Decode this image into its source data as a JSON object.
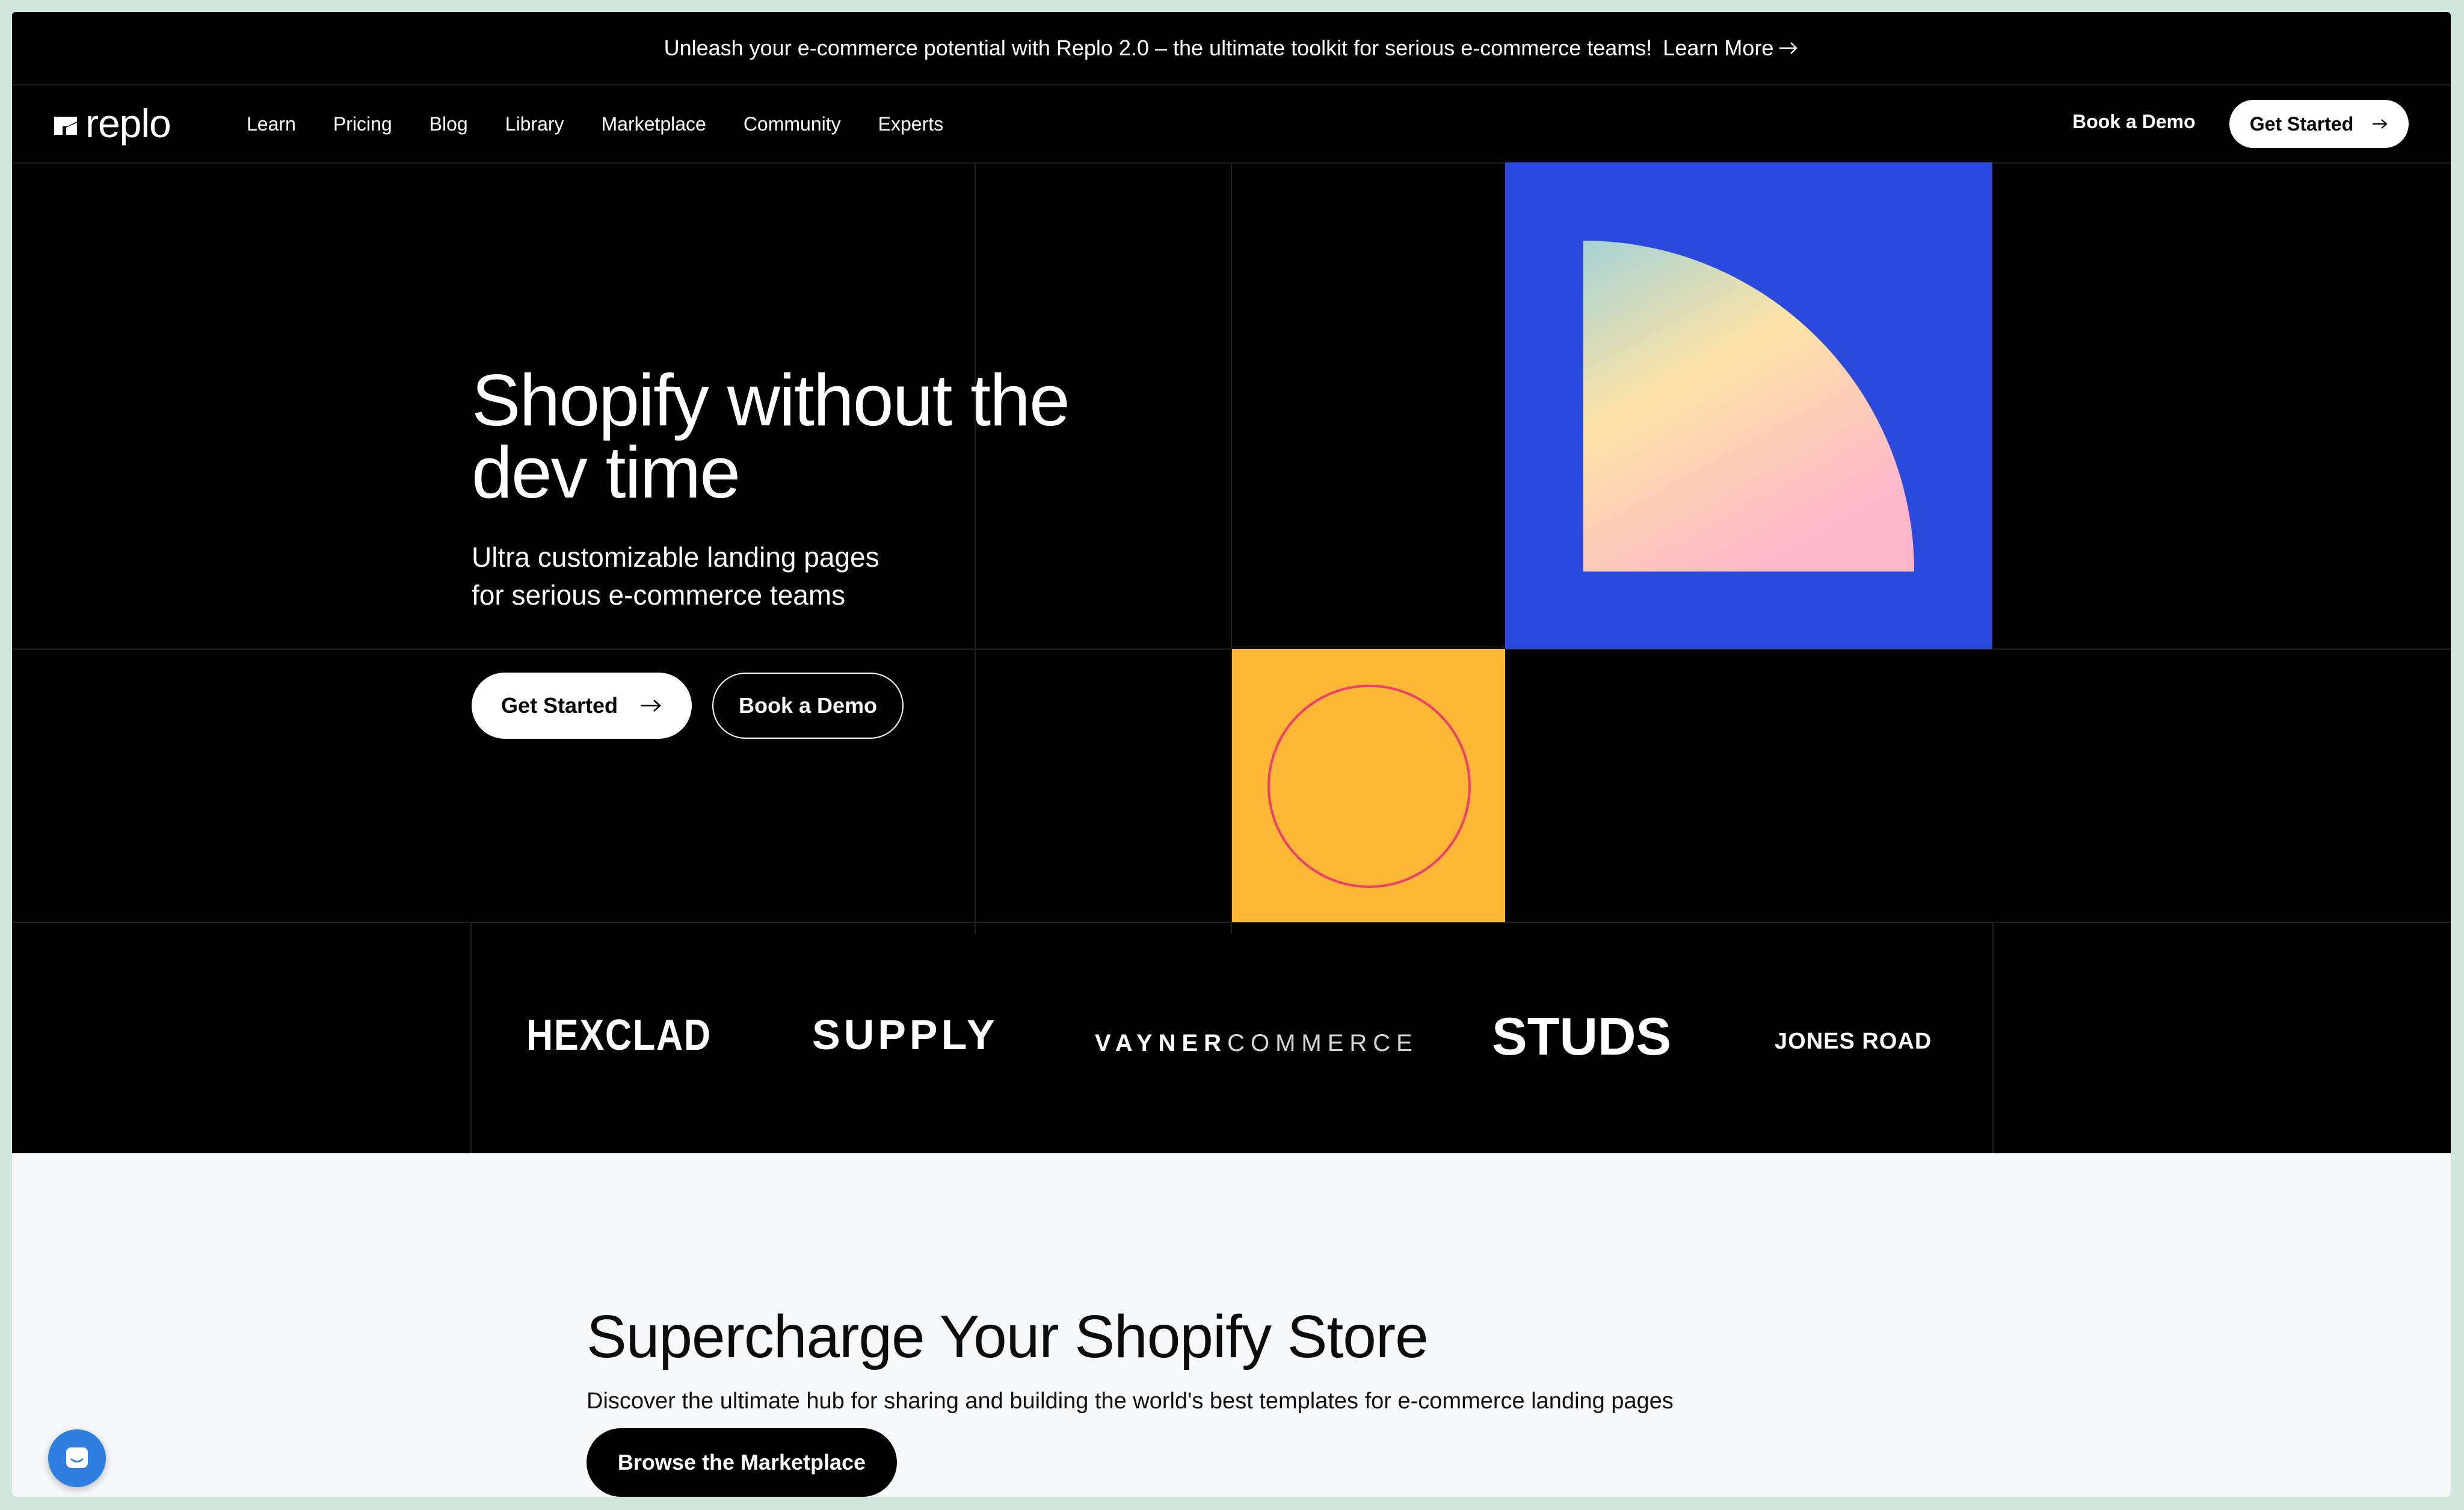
{
  "announcement": {
    "text": "Unleash your e-commerce potential with Replo 2.0 – the ultimate toolkit for serious e-commerce teams!",
    "link_label": "Learn More",
    "link_icon": "arrow-right-icon"
  },
  "header": {
    "brand": "replo",
    "nav": [
      {
        "label": "Learn"
      },
      {
        "label": "Pricing"
      },
      {
        "label": "Blog"
      },
      {
        "label": "Library"
      },
      {
        "label": "Marketplace"
      },
      {
        "label": "Community"
      },
      {
        "label": "Experts"
      }
    ],
    "book_demo_label": "Book a Demo",
    "get_started_label": "Get Started"
  },
  "hero": {
    "title": "Shopify without the dev time",
    "subtitle_lines": [
      "Ultra customizable landing pages",
      "for serious e-commerce teams"
    ],
    "primary_cta": "Get Started",
    "secondary_cta": "Book a Demo",
    "colors": {
      "blue_tile": "#2a4ade",
      "yellow_tile": "#ffb835",
      "circle_stroke": "#ee3f6b"
    }
  },
  "logos": [
    {
      "name": "HEXCLAD"
    },
    {
      "name": "SUPPLY"
    },
    {
      "name_bold": "VAYNER",
      "name_light": "COMMERCE"
    },
    {
      "name": "STUDS"
    },
    {
      "name": "JONES ROAD"
    }
  ],
  "marketplace": {
    "title": "Supercharge Your Shopify Store",
    "description": "Discover the ultimate hub for sharing and building the world's best templates for e-commerce landing pages",
    "cta": "Browse the Marketplace"
  },
  "chat_widget": {
    "icon": "chat-icon",
    "color": "#2e7fe0"
  }
}
